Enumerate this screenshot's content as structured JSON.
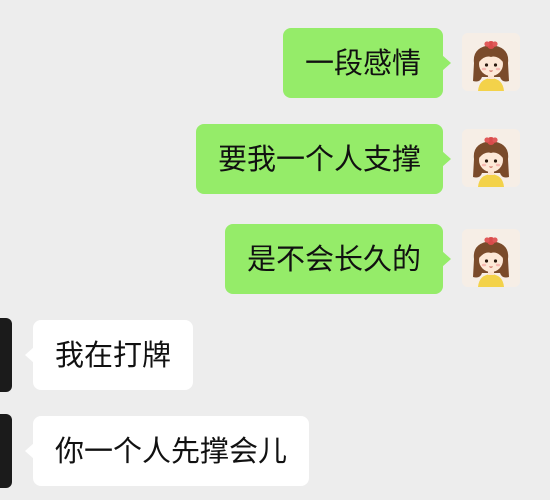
{
  "conversation": {
    "messages": [
      {
        "sender": "self",
        "text": "一段感情",
        "avatar": "girl-avatar-icon"
      },
      {
        "sender": "self",
        "text": "要我一个人支撑",
        "avatar": "girl-avatar-icon"
      },
      {
        "sender": "self",
        "text": "是不会长久的",
        "avatar": "girl-avatar-icon"
      },
      {
        "sender": "other",
        "text": "我在打牌",
        "avatar": "dark-avatar-icon"
      },
      {
        "sender": "other",
        "text": "你一个人先撑会儿",
        "avatar": "dark-avatar-icon"
      }
    ]
  },
  "colors": {
    "background": "#ededed",
    "sent_bubble": "#95ec69",
    "received_bubble": "#ffffff",
    "text": "#111111"
  }
}
